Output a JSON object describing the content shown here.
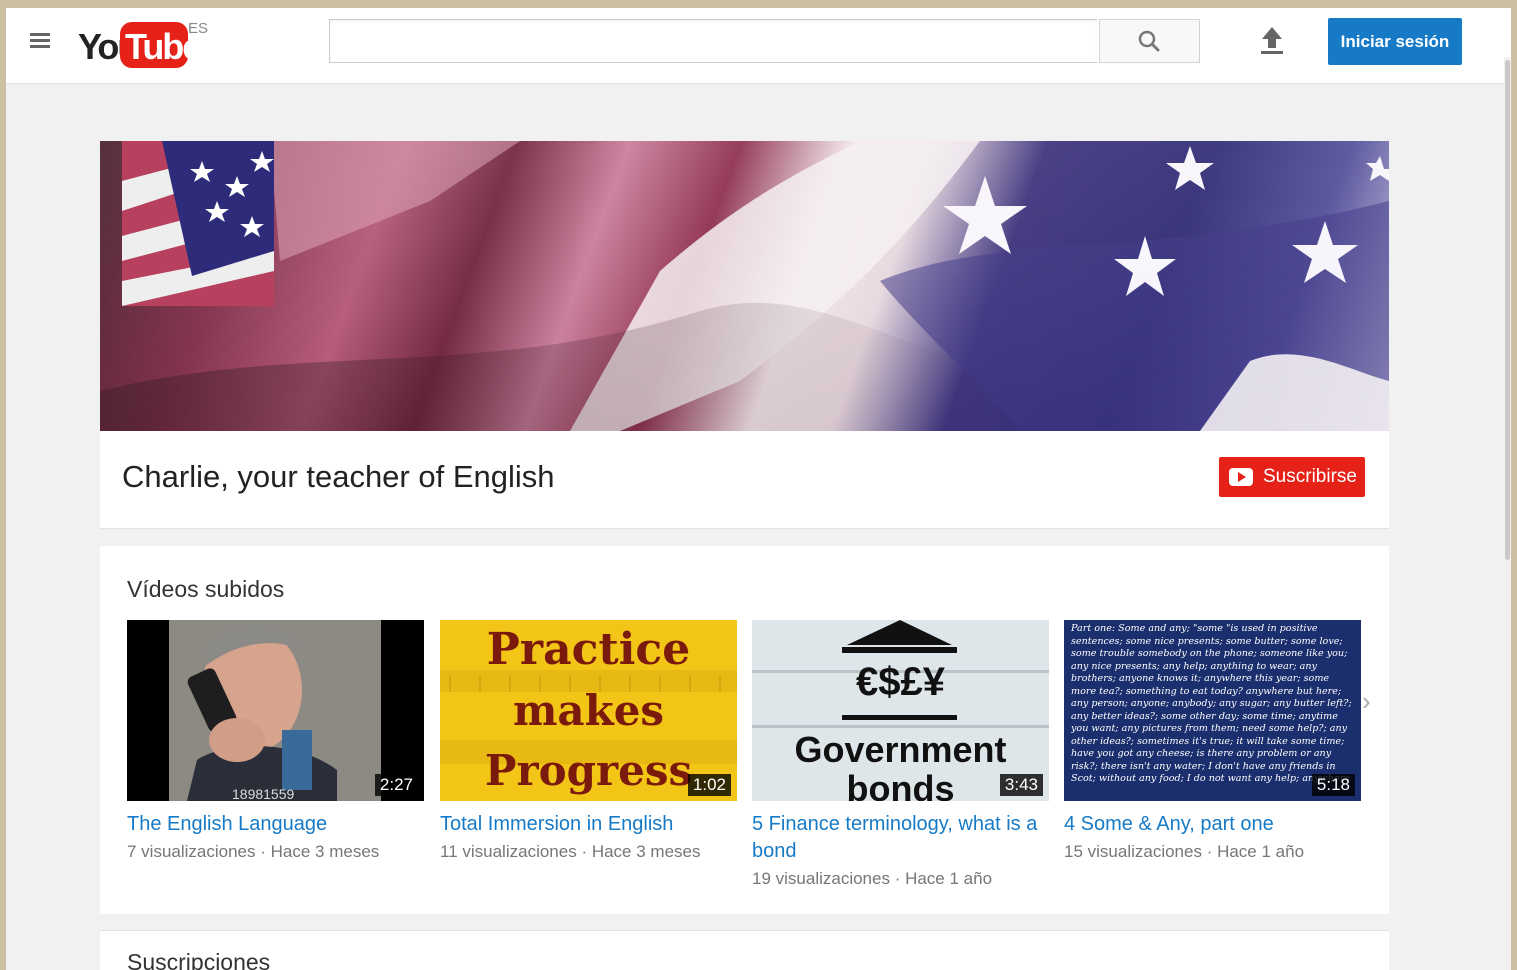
{
  "masthead": {
    "logo_you": "You",
    "logo_tube": "Tube",
    "country_code": "ES",
    "search_value": "",
    "signin_label": "Iniciar sesión"
  },
  "channel": {
    "title": "Charlie, your teacher of English",
    "subscribe_label": "Suscribirse"
  },
  "uploads": {
    "title": "Vídeos subidos",
    "videos": [
      {
        "title": "The English Language",
        "views": "7 visualizaciones",
        "age": "Hace 3 meses",
        "duration": "2:27",
        "thumb_caption": "18981559"
      },
      {
        "title": "Total Immersion in English",
        "views": "11 visualizaciones",
        "age": "Hace 3 meses",
        "duration": "1:02",
        "thumb_lines": [
          "Practice",
          "makes",
          "Progress"
        ]
      },
      {
        "title": "5 Finance terminology, what is a bond",
        "views": "19 visualizaciones",
        "age": "Hace 1 año",
        "duration": "3:43",
        "thumb_lines": [
          "€$£¥",
          "Government",
          "bonds"
        ]
      },
      {
        "title": "4 Some & Any, part one",
        "views": "15 visualizaciones",
        "age": "Hace 1 año",
        "duration": "5:18",
        "thumb_text": "Part one: Some and any; \"some \"is used in positive sentences; some nice presents; some butter; some love; some trouble somebody on the phone; someone like you; any nice presents; any help; anything to wear; any brothers; anyone knows it; anywhere this year; some more tea?; something to eat today? anywhere but here; any person; anyone; anybody; any sugar; any butter left?; any better ideas?; some other day; some time; anytime you want; any pictures from them; need some help?; any other ideas?; sometimes it's true; it will take some time; have you got any cheese; is there any problem or any risk?; there isn't any water; I don't have any friends in Scot; without any food; I do not want any help; anywhere"
      }
    ]
  },
  "subscriptions": {
    "title": "Suscripciones"
  },
  "icons": {
    "menu": "hamburger-icon",
    "search": "search-icon",
    "upload": "upload-icon",
    "next": "chevron-right-icon",
    "subscribe": "youtube-play-icon"
  },
  "colors": {
    "brand_red": "#e62117",
    "link_blue": "#167ac6",
    "signin_blue": "#167ac6"
  }
}
